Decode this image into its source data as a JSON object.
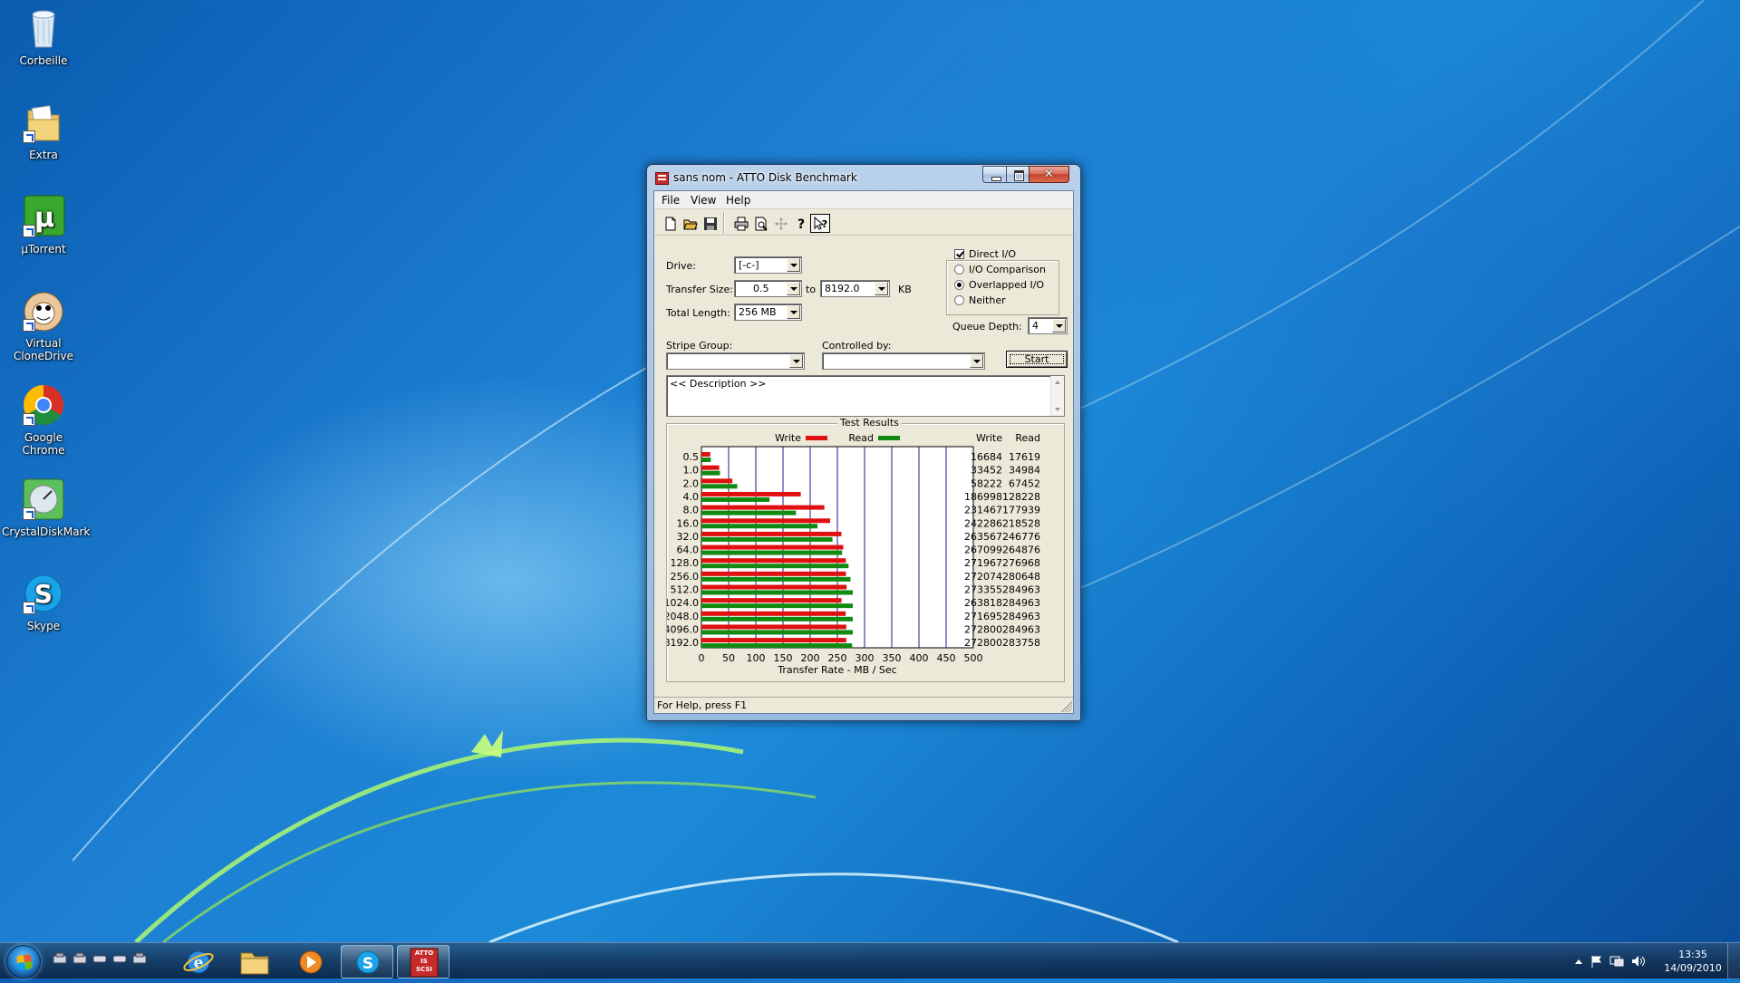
{
  "desktop": {
    "icons": [
      {
        "label": "Corbeille",
        "icon": "recycle-bin-icon"
      },
      {
        "label": "Extra",
        "icon": "folder-icon"
      },
      {
        "label": "µTorrent",
        "icon": "utorrent-icon"
      },
      {
        "label": "Virtual CloneDrive",
        "icon": "virtual-clonedrive-icon"
      },
      {
        "label": "Google Chrome",
        "icon": "chrome-icon"
      },
      {
        "label": "CrystalDiskMark",
        "icon": "crystaldiskmark-icon"
      },
      {
        "label": "Skype",
        "icon": "skype-icon"
      }
    ]
  },
  "window": {
    "title": "sans nom - ATTO Disk Benchmark",
    "close_glyph": "✕",
    "menu": [
      "File",
      "View",
      "Help"
    ],
    "toolbar": [
      {
        "name": "new-icon"
      },
      {
        "name": "open-icon"
      },
      {
        "name": "save-icon"
      },
      {
        "name": "print-icon"
      },
      {
        "name": "print-preview-icon"
      },
      {
        "name": "move-icon"
      },
      {
        "name": "help-icon"
      },
      {
        "name": "context-help-icon"
      }
    ],
    "drive": {
      "label": "Drive:",
      "value": "[-c-]"
    },
    "transfer_size": {
      "label": "Transfer Size:",
      "from": "0.5",
      "to_label": "to",
      "to": "8192.0",
      "unit": "KB"
    },
    "total_length": {
      "label": "Total Length:",
      "value": "256 MB"
    },
    "direct_io": {
      "label": "Direct I/O",
      "checked": true
    },
    "io_modes": {
      "options": [
        "I/O Comparison",
        "Overlapped I/O",
        "Neither"
      ],
      "selected": "Overlapped I/O"
    },
    "queue_depth": {
      "label": "Queue Depth:",
      "value": "4"
    },
    "stripe_group": {
      "label": "Stripe Group:",
      "value": ""
    },
    "controlled_by": {
      "label": "Controlled by:",
      "value": ""
    },
    "start_label": "Start",
    "description": "<< Description >>",
    "results_title": "Test Results",
    "status": "For Help, press F1"
  },
  "chart_data": {
    "type": "bar",
    "title": "Test Results",
    "xlabel": "Transfer Rate - MB / Sec",
    "xlim": [
      0,
      500
    ],
    "x_ticks": [
      0,
      50,
      100,
      150,
      200,
      250,
      300,
      350,
      400,
      450,
      500
    ],
    "categories": [
      "0.5",
      "1.0",
      "2.0",
      "4.0",
      "8.0",
      "16.0",
      "32.0",
      "64.0",
      "128.0",
      "256.0",
      "512.0",
      "1024.0",
      "2048.0",
      "4096.0",
      "8192.0"
    ],
    "series": [
      {
        "name": "Write",
        "color": "#e01010",
        "values": [
          16684,
          33452,
          58222,
          186998,
          231467,
          242286,
          263567,
          267099,
          271967,
          272074,
          273355,
          263818,
          271695,
          272800,
          272800
        ]
      },
      {
        "name": "Read",
        "color": "#108a10",
        "values": [
          17619,
          34984,
          67452,
          128228,
          177939,
          218528,
          246776,
          264876,
          276968,
          280648,
          284963,
          284963,
          284963,
          284963,
          283758
        ]
      }
    ],
    "value_columns": [
      "Write",
      "Read"
    ],
    "kb_per_mb": 1024,
    "legend": "top"
  },
  "taskbar": {
    "quick_launch": [
      "quick-launch-icon-1",
      "quick-launch-icon-2",
      "quick-launch-icon-3",
      "quick-launch-icon-4",
      "quick-launch-icon-5"
    ],
    "items": [
      "internet-explorer-icon",
      "explorer-icon",
      "media-player-icon",
      "skype-icon",
      "atto-icon"
    ],
    "atto_badge": "ATTO IS SCSI",
    "clock_time": "13:35",
    "clock_date": "14/09/2010"
  }
}
